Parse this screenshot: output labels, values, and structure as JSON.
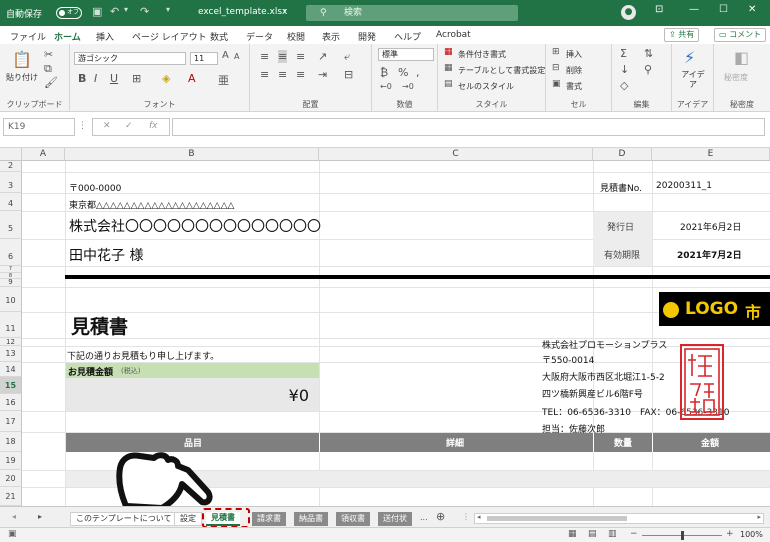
{
  "titlebar": {
    "autosave": "自動保存",
    "autosave_state": "オフ",
    "filename": "excel_template.xlsx",
    "search_placeholder": "検索"
  },
  "ribbon_tabs": [
    "ファイル",
    "ホーム",
    "挿入",
    "ページ レイアウト",
    "数式",
    "データ",
    "校閲",
    "表示",
    "開発",
    "ヘルプ",
    "Acrobat"
  ],
  "share": {
    "share": "共有",
    "comment": "コメント"
  },
  "ribbon": {
    "paste": "貼り付け",
    "clipboard": "クリップボード",
    "font_name": "游ゴシック",
    "font_size": "11",
    "font_group": "フォント",
    "align_group": "配置",
    "number_format": "標準",
    "number_group": "数値",
    "cond_format": "条件付き書式",
    "table_format": "テーブルとして書式設定",
    "cell_style": "セルのスタイル",
    "style_group": "スタイル",
    "insert": "挿入",
    "delete": "削除",
    "format": "書式",
    "cell_group": "セル",
    "edit_group": "編集",
    "idea": "アイデア",
    "idea_group": "アイデア",
    "sensitivity": "秘密度",
    "sensitivity_group": "秘密度"
  },
  "formula": {
    "namebox": "K19",
    "fx": "fx"
  },
  "columns": [
    "A",
    "B",
    "C",
    "D",
    "E"
  ],
  "rows": [
    "2",
    "3",
    "4",
    "5",
    "6",
    "7",
    "8",
    "9",
    "10",
    "11",
    "12",
    "13",
    "14",
    "15",
    "16",
    "17",
    "18",
    "19",
    "20",
    "21"
  ],
  "selected_row": "15",
  "cells": {
    "postal": "〒000-0000",
    "address": "東京都△△△△△△△△△△△△△△△△△△△△",
    "company": "株式会社〇〇〇〇〇〇〇〇〇〇〇〇〇〇",
    "recipient": "田中花子 様",
    "quote_no_label": "見積書No.",
    "quote_no": "20200311_1",
    "issue_label": "発行日",
    "issue_date": "2021年6月2日",
    "expiry_label": "有効期限",
    "expiry_date": "2021年7月2日",
    "title": "見積書",
    "intro": "下記の通りお見積もり申し上げます。",
    "amount_label": "お見積金額",
    "amount_tax": "(税込)",
    "amount": "¥0",
    "logo_text": "LOGO",
    "logo_suffix": "市",
    "sender_company": "株式会社プロモーションプラス",
    "sender_postal": "〒550-0014",
    "sender_addr1": "大阪府大阪市西区北堀江1-5-2",
    "sender_addr2": "四ツ橋新興産ビル6階F号",
    "sender_tel": "TEL：06-6536-3310",
    "sender_fax": "FAX：06-6536-3310",
    "sender_person": "担当：佐藤次郎",
    "stamp_text": "株式会社プロモーションプラス",
    "header_item": "品目",
    "header_detail": "詳細",
    "header_qty": "数量",
    "header_price": "金額"
  },
  "sheet_tabs": [
    "このテンプレートについて",
    "設定",
    "見積書",
    "請求書",
    "納品書",
    "領収書",
    "送付状",
    "..."
  ],
  "active_sheet": "見積書",
  "status": {
    "zoom": "100%"
  },
  "colors": {
    "excel_green": "#217346",
    "amount_bg": "#c6e0b4",
    "header_gray": "#7f7f7f",
    "stamp_red": "#d9262b",
    "highlight_red": "#c00000"
  }
}
